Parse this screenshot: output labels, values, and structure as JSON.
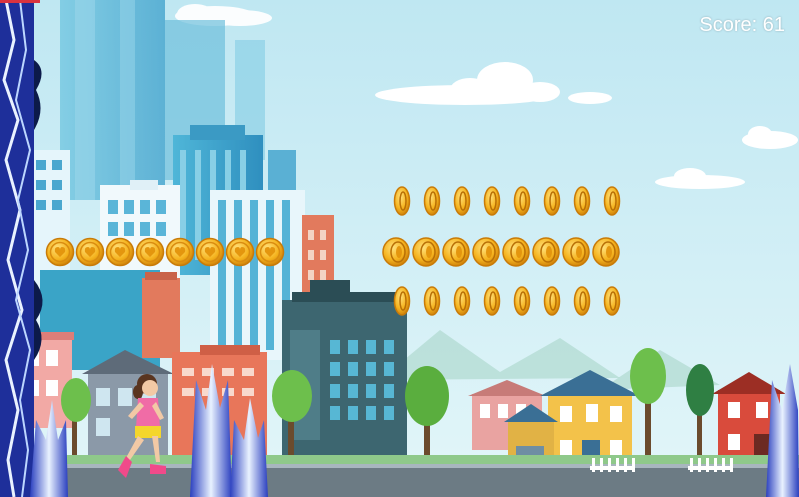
{
  "hud": {
    "score_label": "Score:",
    "score_value": "61"
  },
  "colors": {
    "sky": "#c9ecf3",
    "coin": "#f5b31e",
    "coin_dark": "#c97b08",
    "lightning": "#dce9ff"
  },
  "coins": {
    "row_left_count": 8,
    "row_top_count": 8,
    "row_middle_count": 8,
    "row_bottom_count": 8
  }
}
